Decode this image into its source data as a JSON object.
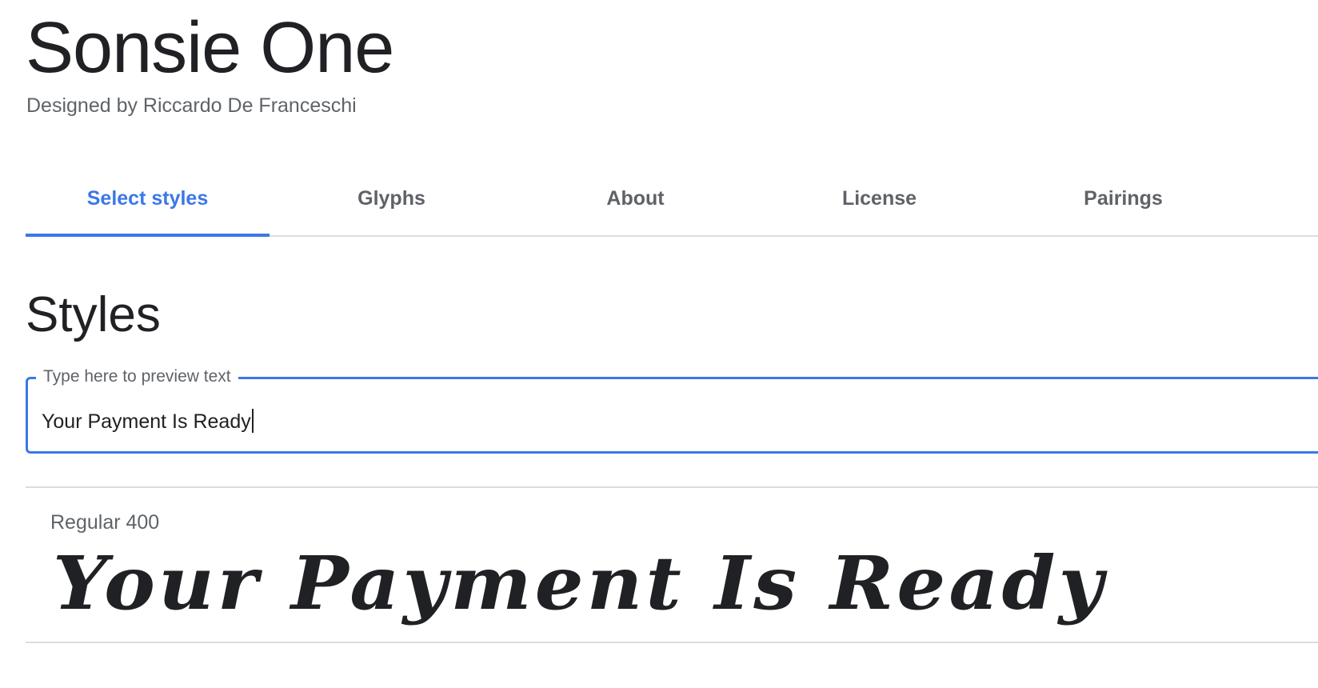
{
  "font": {
    "name": "Sonsie One",
    "designer_line": "Designed by Riccardo De Franceschi"
  },
  "tabs": [
    {
      "label": "Select styles",
      "active": true
    },
    {
      "label": "Glyphs",
      "active": false
    },
    {
      "label": "About",
      "active": false
    },
    {
      "label": "License",
      "active": false
    },
    {
      "label": "Pairings",
      "active": false
    }
  ],
  "styles_section": {
    "heading": "Styles",
    "preview_field": {
      "label": "Type here to preview text",
      "value": "Your Payment Is Ready"
    },
    "styles": [
      {
        "name": "Regular 400",
        "sample_text": "Your Payment Is Ready"
      }
    ]
  },
  "colors": {
    "accent": "#3b78e7",
    "text_primary": "#202124",
    "text_secondary": "#5f6368",
    "divider": "#dadce0"
  }
}
